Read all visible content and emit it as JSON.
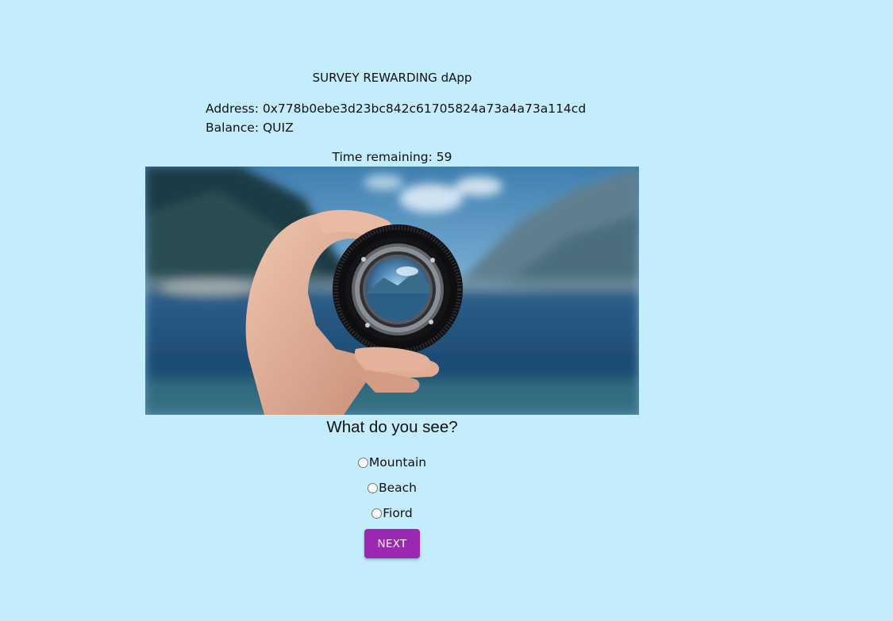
{
  "app": {
    "title": "SURVEY REWARDING dApp"
  },
  "account": {
    "address_label": "Address:",
    "address_value": "0x778b0ebe3d23bc842c61705824a73a4a73a114cd",
    "balance_label": "Balance:",
    "balance_value": "QUIZ"
  },
  "timer": {
    "label": "Time remaining:",
    "value": "59"
  },
  "quiz": {
    "image_icon": "lens-landscape-photo",
    "question": "What do you see?",
    "options": [
      {
        "label": "Mountain",
        "selected": false
      },
      {
        "label": "Beach",
        "selected": false
      },
      {
        "label": "Fiord",
        "selected": false
      }
    ],
    "next_label": "NEXT"
  },
  "colors": {
    "background": "#c3ecfd",
    "button": "#9a28b0",
    "button_text": "#ffffff",
    "text": "#111111"
  }
}
